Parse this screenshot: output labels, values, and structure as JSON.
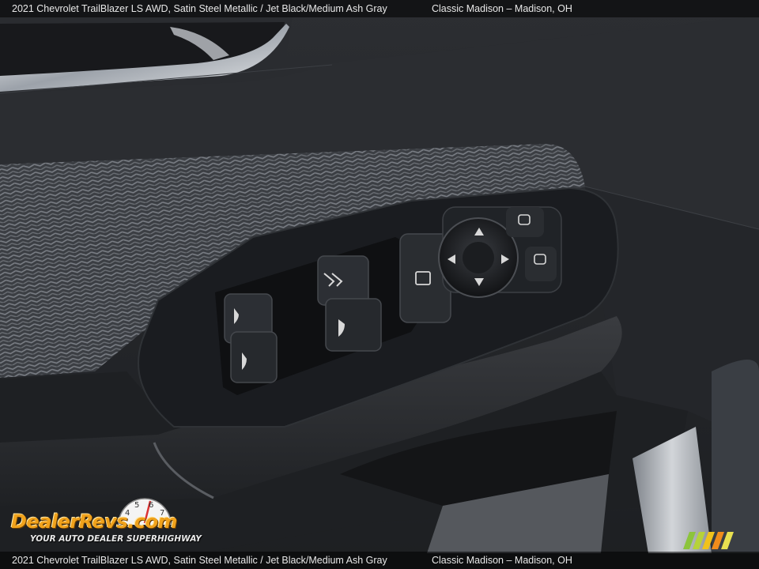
{
  "caption": {
    "vehicle": "2021 Chevrolet TrailBlazer LS AWD,  Satin Steel Metallic / Jet Black/Medium Ash Gray",
    "dealer": "Classic Madison – Madison, OH"
  },
  "watermark": {
    "brand": "DealerRevs.com",
    "tagline": "YOUR AUTO DEALER SUPERHIGHWAY",
    "tach_digits": [
      "4",
      "5",
      "6",
      "7"
    ]
  },
  "colors": {
    "door_trim": "#26282c",
    "herringbone_fabric": "#4a4d52",
    "switch_panel": "#16181c",
    "chrome": "#c8ccd2",
    "logo_orange": "#f0a21c",
    "stripe_green": "#8cc43c"
  },
  "icons": [
    "window-up-down-icon",
    "window-lock-icon",
    "door-lock-icon",
    "mirror-adjust-joystick-icon",
    "mirror-left-select-icon",
    "mirror-right-select-icon"
  ]
}
